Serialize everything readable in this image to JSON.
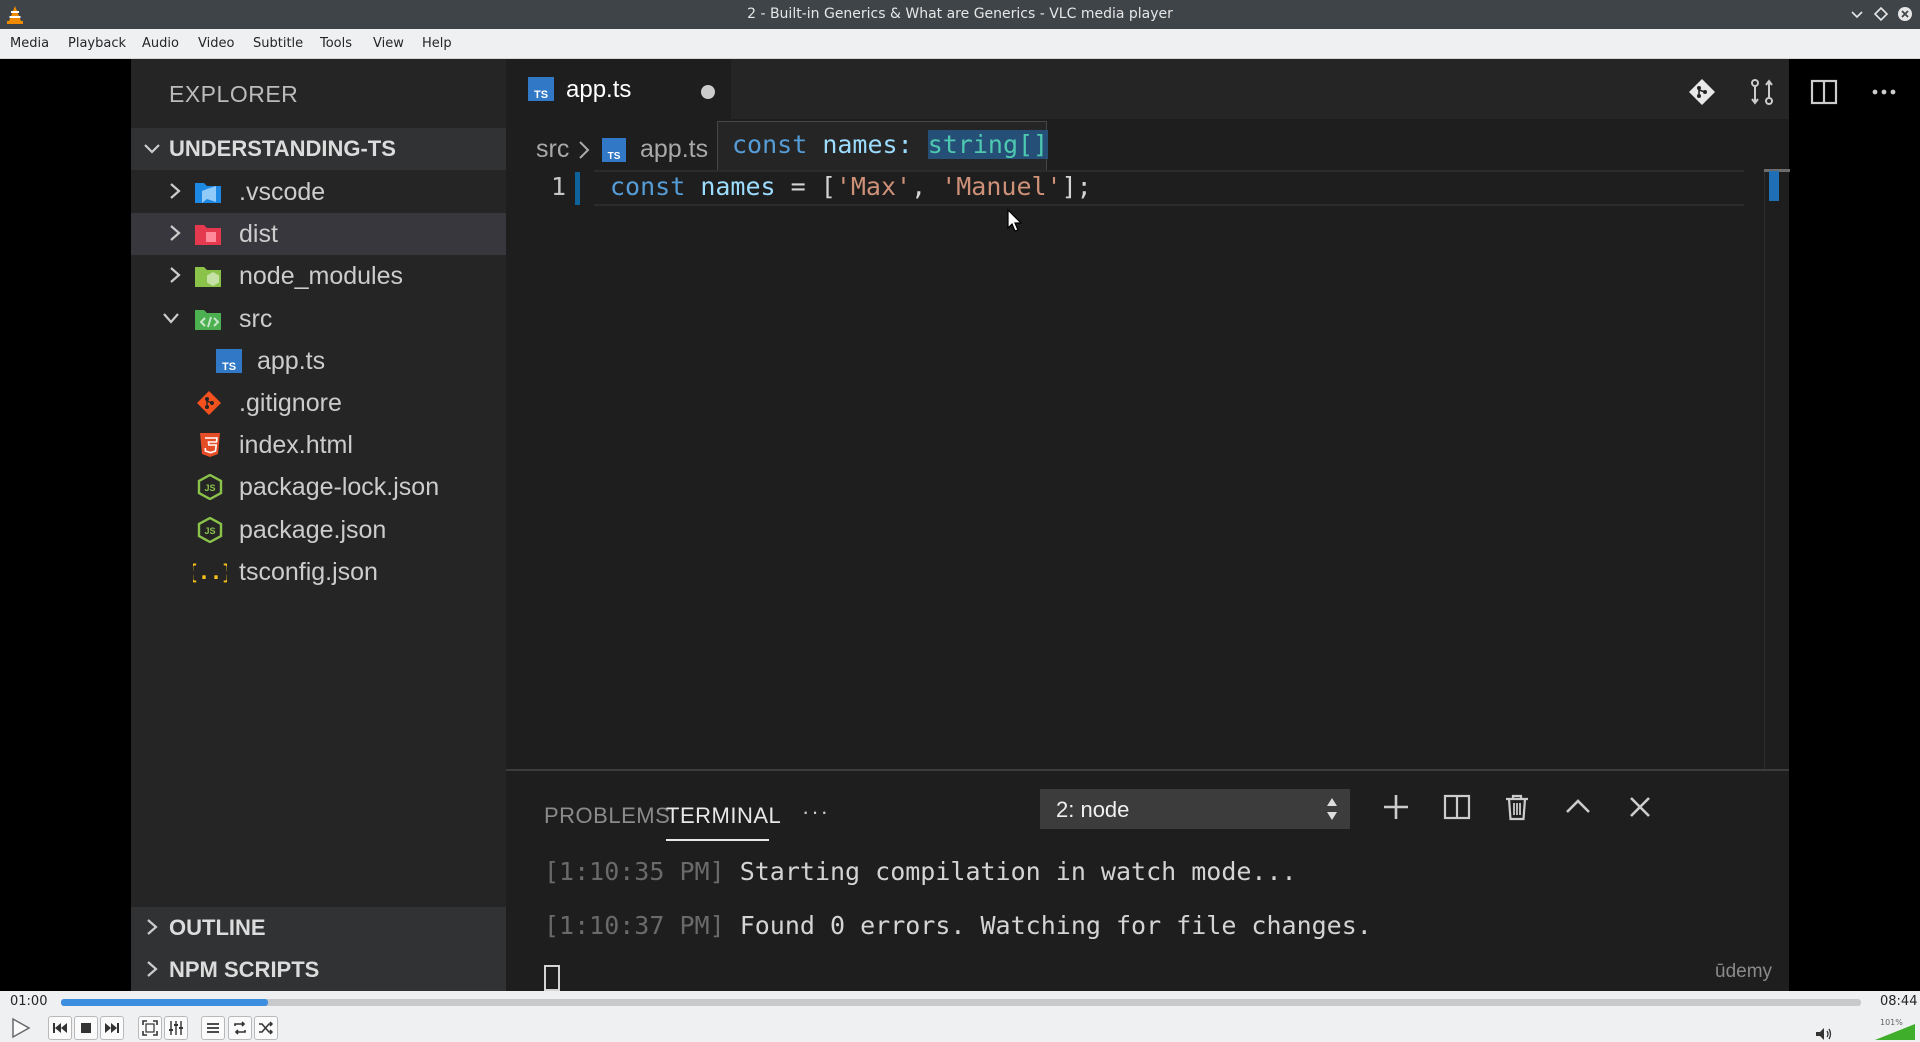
{
  "window": {
    "title": "2 - Built-in Generics & What are Generics - VLC media player",
    "controls": [
      "minimize",
      "maximize",
      "close"
    ]
  },
  "menubar": [
    "Media",
    "Playback",
    "Audio",
    "Video",
    "Subtitle",
    "Tools",
    "View",
    "Help"
  ],
  "explorer": {
    "header": "EXPLORER",
    "project": "UNDERSTANDING-TS",
    "items": [
      {
        "name": ".vscode",
        "icon": "folder-vscode-icon",
        "type": "folder",
        "expanded": false
      },
      {
        "name": "dist",
        "icon": "folder-dist-icon",
        "type": "folder",
        "expanded": false,
        "selected": true
      },
      {
        "name": "node_modules",
        "icon": "folder-node-icon",
        "type": "folder",
        "expanded": false
      },
      {
        "name": "src",
        "icon": "folder-src-icon",
        "type": "folder",
        "expanded": true
      },
      {
        "name": "app.ts",
        "icon": "typescript-file-icon",
        "type": "file"
      },
      {
        "name": ".gitignore",
        "icon": "git-file-icon",
        "type": "file"
      },
      {
        "name": "index.html",
        "icon": "html5-file-icon",
        "type": "file"
      },
      {
        "name": "package-lock.json",
        "icon": "nodejs-file-icon",
        "type": "file"
      },
      {
        "name": "package.json",
        "icon": "nodejs-file-icon",
        "type": "file"
      },
      {
        "name": "tsconfig.json",
        "icon": "json-file-icon",
        "type": "file"
      }
    ],
    "sections": [
      "OUTLINE",
      "NPM SCRIPTS"
    ]
  },
  "editor": {
    "tab": {
      "label": "app.ts",
      "badge": "TS",
      "dirty": true
    },
    "breadcrumb": {
      "folder": "src",
      "file": "app.ts",
      "badge": "TS"
    },
    "hover": {
      "keyword": "const",
      "name": "names:",
      "type": "string[]"
    },
    "line_number": "1",
    "code": {
      "keyword": "const",
      "name": "names",
      "rest_open": " = [",
      "str1": "'Max'",
      "comma": ", ",
      "str2": "'Manuel'",
      "rest_close": "];"
    }
  },
  "panel": {
    "tabs": [
      "PROBLEMS",
      "TERMINAL"
    ],
    "active_tab": "TERMINAL",
    "more": "···",
    "terminal_select": "2: node",
    "lines": [
      {
        "time": "[1:10:35 PM]",
        "message": "Starting compilation in watch mode..."
      },
      {
        "time": "[1:10:37 PM]",
        "message": "Found 0 errors. Watching for file changes."
      }
    ]
  },
  "watermark": "ūdemy",
  "player": {
    "time_current": "01:00",
    "time_total": "08:44",
    "progress": 0.115,
    "volume_label": "101%",
    "volume": 1.01
  },
  "colors": {
    "accent": "#3d8ee0",
    "vscode_bg": "#1e1e1e",
    "sidebar_bg": "#252526",
    "ts_blue": "#3178c6"
  }
}
